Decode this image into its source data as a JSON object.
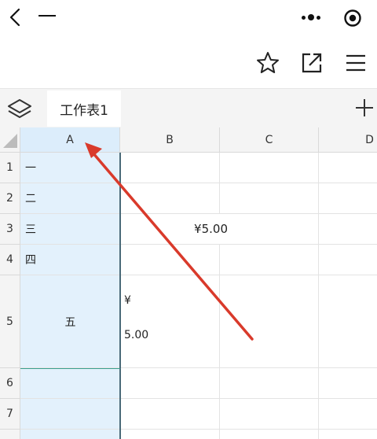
{
  "nav": {
    "back_icon": "chevron-left-icon",
    "title": "一",
    "more_icon": "ellipsis-icon",
    "close_icon": "target-icon"
  },
  "toolbar": {
    "star_icon": "star-icon",
    "share_icon": "share-external-icon",
    "menu_icon": "hamburger-menu-icon"
  },
  "sheetbar": {
    "layers_icon": "layers-icon",
    "active_sheet": "工作表1",
    "add_icon": "plus-icon"
  },
  "spreadsheet": {
    "columns": [
      "A",
      "B",
      "C",
      "D"
    ],
    "selected_column": "A",
    "rows": [
      "1",
      "2",
      "3",
      "4",
      "5",
      "6",
      "7"
    ],
    "cells": {
      "A1": "一",
      "A2": "二",
      "A3": "三",
      "A4": "四",
      "A5": "五",
      "B3": "¥5.00",
      "B5_line1": "¥",
      "B5_line2": "5.00"
    }
  },
  "annotation": {
    "arrow_color": "#d93a2b"
  }
}
